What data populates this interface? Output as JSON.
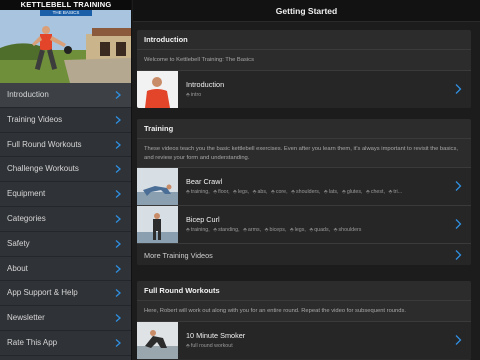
{
  "sidebar": {
    "hero_title": "KETTLEBELL TRAINING",
    "hero_subtitle": "THE BASICS",
    "items": [
      {
        "label": "Introduction",
        "active": true
      },
      {
        "label": "Training Videos",
        "active": false
      },
      {
        "label": "Full Round Workouts",
        "active": false
      },
      {
        "label": "Challenge Workouts",
        "active": false
      },
      {
        "label": "Equipment",
        "active": false
      },
      {
        "label": "Categories",
        "active": false
      },
      {
        "label": "Safety",
        "active": false
      },
      {
        "label": "About",
        "active": false
      },
      {
        "label": "App Support & Help",
        "active": false
      },
      {
        "label": "Newsletter",
        "active": false
      },
      {
        "label": "Rate This App",
        "active": false
      }
    ]
  },
  "header": {
    "title": "Getting Started"
  },
  "sections": {
    "introduction": {
      "title": "Introduction",
      "description": "Welcome to Kettlebell Training: The Basics",
      "rows": [
        {
          "title": "Introduction",
          "tags": [
            "intro"
          ]
        }
      ]
    },
    "training": {
      "title": "Training",
      "description": "These videos teach you the basic kettlebell exercises. Even after you learn them, it's always important to revisit the basics, and review your form and understanding.",
      "rows": [
        {
          "title": "Bear Crawl",
          "tags": [
            "training",
            "floor",
            "legs",
            "abs",
            "core",
            "shoulders",
            "lats",
            "glutes",
            "chest",
            "tri..."
          ]
        },
        {
          "title": "Bicep Curl",
          "tags": [
            "training",
            "standing",
            "arms",
            "biceps",
            "legs",
            "quads",
            "shoulders"
          ]
        }
      ],
      "more_label": "More Training Videos"
    },
    "full_round": {
      "title": "Full Round Workouts",
      "description": "Here, Robert will work out along with you for an entire round. Repeat the video for subsequent rounds.",
      "rows": [
        {
          "title": "10 Minute Smoker",
          "tags": [
            "full round workout"
          ]
        }
      ]
    }
  },
  "colors": {
    "chevron": "#2f8fe0",
    "accent_shirt": "#e2452a"
  },
  "icons": {
    "chevron": "chevron-right-icon",
    "tag": "tag-icon"
  }
}
